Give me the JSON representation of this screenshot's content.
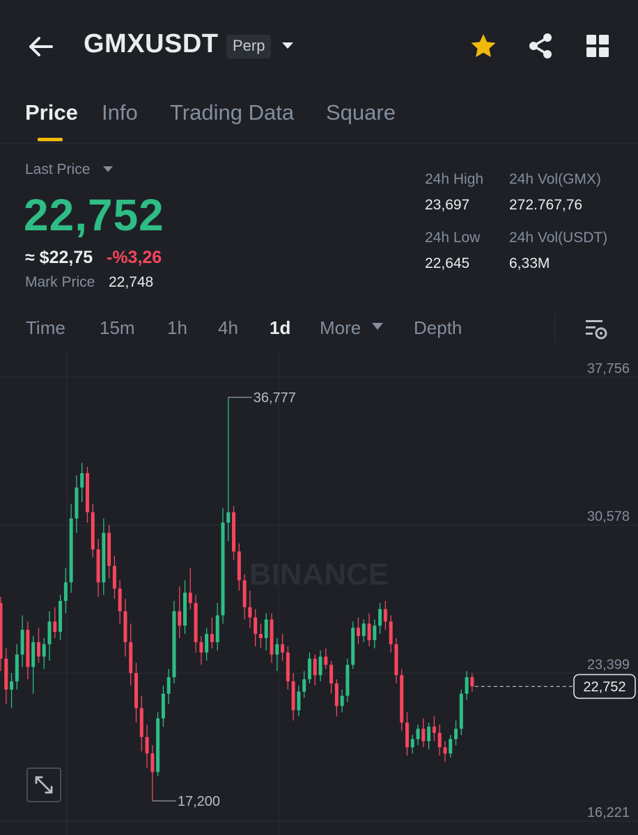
{
  "header": {
    "symbol": "GMXUSDT",
    "contract_type": "Perp",
    "icons": [
      "back-arrow-icon",
      "chevron-down-icon",
      "star-icon",
      "share-icon",
      "grid-icon"
    ],
    "star_color": "#f0b90b"
  },
  "tabs": [
    {
      "label": "Price",
      "active": true
    },
    {
      "label": "Info",
      "active": false
    },
    {
      "label": "Trading Data",
      "active": false
    },
    {
      "label": "Square",
      "active": false
    }
  ],
  "ticker": {
    "last_price_label": "Last Price",
    "last_price": "22,752",
    "fiat_value": "≈ $22,75",
    "change": "-%3,26",
    "mark_price_label": "Mark Price",
    "mark_price": "22,748",
    "up_color": "#2ebd85",
    "down_color": "#f6465d"
  },
  "stats": {
    "high_label": "24h High",
    "high": "23,697",
    "vol_base_label": "24h Vol(GMX)",
    "vol_base": "272.767,76",
    "low_label": "24h Low",
    "low": "22,645",
    "vol_quote_label": "24h Vol(USDT)",
    "vol_quote": "6,33M"
  },
  "intervals": [
    {
      "label": "Time",
      "active": false
    },
    {
      "label": "15m",
      "active": false
    },
    {
      "label": "1h",
      "active": false
    },
    {
      "label": "4h",
      "active": false
    },
    {
      "label": "1d",
      "active": true
    },
    {
      "label": "More",
      "active": false
    },
    {
      "label": "Depth",
      "active": false
    }
  ],
  "chart": {
    "watermark": "BINANCE",
    "y_labels": [
      "37,756",
      "30,578",
      "23,399",
      "16,221"
    ],
    "high_marker": "36,777",
    "low_marker": "17,200",
    "current_price_tag": "22,752"
  },
  "chart_data": {
    "type": "candlestick",
    "interval": "1d",
    "ylim": [
      16.221,
      37.756
    ],
    "y_ticks": [
      37.756,
      30.578,
      23.399,
      16.221
    ],
    "high": 36.777,
    "low": 17.2,
    "last": 22.752,
    "ohlc": [
      [
        26.8,
        27.1,
        23.5,
        24.1
      ],
      [
        24.1,
        24.6,
        21.9,
        22.6
      ],
      [
        22.6,
        23.4,
        21.7,
        23.0
      ],
      [
        23.0,
        24.8,
        22.6,
        24.3
      ],
      [
        24.3,
        26.2,
        23.7,
        25.5
      ],
      [
        25.5,
        25.9,
        23.1,
        23.7
      ],
      [
        23.7,
        25.2,
        22.4,
        24.9
      ],
      [
        24.9,
        25.6,
        23.9,
        24.2
      ],
      [
        24.2,
        25.1,
        23.6,
        24.8
      ],
      [
        24.8,
        26.4,
        24.0,
        25.9
      ],
      [
        25.9,
        26.6,
        25.1,
        25.4
      ],
      [
        25.4,
        27.2,
        25.0,
        26.9
      ],
      [
        26.9,
        28.5,
        26.3,
        27.8
      ],
      [
        27.8,
        31.6,
        27.3,
        30.9
      ],
      [
        30.9,
        33.0,
        30.2,
        32.4
      ],
      [
        32.4,
        33.6,
        31.7,
        33.1
      ],
      [
        33.1,
        33.4,
        30.7,
        31.2
      ],
      [
        31.2,
        31.6,
        29.0,
        29.4
      ],
      [
        29.4,
        29.9,
        27.1,
        27.8
      ],
      [
        27.8,
        30.9,
        27.2,
        30.2
      ],
      [
        30.2,
        30.6,
        28.0,
        28.6
      ],
      [
        28.6,
        29.1,
        27.0,
        27.5
      ],
      [
        27.5,
        27.9,
        25.8,
        26.4
      ],
      [
        26.4,
        27.0,
        24.2,
        24.9
      ],
      [
        24.9,
        25.8,
        22.8,
        23.4
      ],
      [
        23.4,
        23.9,
        21.0,
        21.7
      ],
      [
        21.7,
        22.3,
        19.6,
        20.3
      ],
      [
        20.3,
        20.9,
        18.8,
        19.5
      ],
      [
        19.5,
        19.9,
        17.2,
        18.6
      ],
      [
        18.6,
        21.5,
        18.4,
        21.2
      ],
      [
        21.2,
        22.8,
        20.8,
        22.4
      ],
      [
        22.4,
        23.6,
        21.9,
        23.2
      ],
      [
        23.2,
        26.9,
        22.9,
        26.4
      ],
      [
        26.4,
        27.6,
        25.1,
        25.7
      ],
      [
        25.7,
        27.9,
        25.3,
        27.3
      ],
      [
        27.3,
        28.5,
        26.5,
        26.8
      ],
      [
        26.8,
        27.2,
        24.4,
        24.9
      ],
      [
        24.9,
        25.2,
        23.8,
        24.4
      ],
      [
        24.4,
        25.6,
        24.0,
        25.3
      ],
      [
        25.3,
        26.1,
        24.6,
        24.9
      ],
      [
        24.9,
        26.8,
        24.5,
        26.2
      ],
      [
        26.2,
        31.4,
        25.8,
        30.7
      ],
      [
        30.7,
        36.777,
        29.8,
        31.2
      ],
      [
        31.2,
        31.5,
        28.9,
        29.3
      ],
      [
        29.3,
        29.7,
        27.4,
        27.9
      ],
      [
        27.9,
        28.2,
        26.0,
        26.6
      ],
      [
        26.6,
        27.4,
        25.6,
        26.1
      ],
      [
        26.1,
        26.5,
        24.7,
        25.3
      ],
      [
        25.3,
        25.8,
        24.6,
        25.1
      ],
      [
        25.1,
        26.3,
        24.5,
        26.0
      ],
      [
        26.0,
        26.3,
        23.9,
        24.3
      ],
      [
        24.3,
        25.1,
        23.5,
        24.8
      ],
      [
        24.8,
        25.3,
        24.0,
        24.4
      ],
      [
        24.4,
        24.7,
        22.6,
        23.0
      ],
      [
        23.0,
        23.4,
        21.1,
        21.6
      ],
      [
        21.6,
        22.8,
        21.3,
        22.5
      ],
      [
        22.5,
        23.5,
        22.2,
        23.1
      ],
      [
        23.1,
        24.4,
        22.9,
        24.1
      ],
      [
        24.1,
        24.3,
        22.8,
        23.3
      ],
      [
        23.3,
        24.5,
        23.0,
        24.2
      ],
      [
        24.2,
        24.6,
        23.6,
        23.8
      ],
      [
        23.8,
        24.0,
        22.4,
        22.9
      ],
      [
        22.9,
        23.1,
        21.3,
        21.8
      ],
      [
        21.8,
        22.6,
        21.5,
        22.3
      ],
      [
        22.3,
        24.1,
        22.0,
        23.8
      ],
      [
        23.8,
        25.9,
        23.6,
        25.6
      ],
      [
        25.6,
        26.1,
        24.8,
        25.2
      ],
      [
        25.2,
        26.0,
        24.9,
        25.8
      ],
      [
        25.8,
        26.3,
        24.7,
        25.0
      ],
      [
        25.0,
        26.0,
        24.6,
        25.7
      ],
      [
        25.7,
        26.8,
        25.3,
        26.5
      ],
      [
        26.5,
        26.9,
        25.5,
        25.9
      ],
      [
        25.9,
        26.2,
        24.4,
        24.8
      ],
      [
        24.8,
        25.1,
        22.9,
        23.3
      ],
      [
        23.3,
        23.6,
        20.6,
        21.0
      ],
      [
        21.0,
        21.5,
        19.4,
        19.8
      ],
      [
        19.8,
        20.4,
        19.5,
        20.2
      ],
      [
        20.2,
        20.9,
        19.9,
        20.7
      ],
      [
        20.7,
        21.2,
        19.8,
        20.1
      ],
      [
        20.1,
        21.0,
        19.7,
        20.8
      ],
      [
        20.8,
        21.3,
        20.1,
        20.5
      ],
      [
        20.5,
        20.9,
        19.4,
        19.8
      ],
      [
        19.8,
        20.1,
        19.1,
        19.5
      ],
      [
        19.5,
        20.4,
        19.3,
        20.2
      ],
      [
        20.2,
        21.1,
        19.9,
        20.7
      ],
      [
        20.7,
        22.6,
        20.4,
        22.4
      ],
      [
        22.4,
        23.5,
        22.1,
        23.2
      ],
      [
        23.2,
        23.4,
        22.5,
        22.752
      ]
    ]
  }
}
